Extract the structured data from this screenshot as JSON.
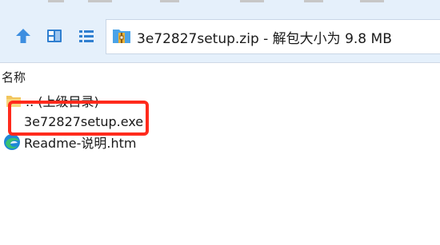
{
  "address_bar": {
    "title": "3e72827setup.zip - 解包大小为 9.8 MB"
  },
  "toolbar": {
    "buttons": [
      {
        "icon": "up-arrow-icon"
      },
      {
        "icon": "view-tiles-icon"
      },
      {
        "icon": "view-list-icon"
      }
    ]
  },
  "column_header": {
    "name_label": "名称"
  },
  "files": [
    {
      "name": ".. (上级目录)",
      "icon": "folder-icon"
    },
    {
      "name": "3e72827setup.exe",
      "icon": "none"
    },
    {
      "name": "Readme-说明.htm",
      "icon": "edge-browser-icon"
    }
  ],
  "colors": {
    "toolbar_bg": "#e5f0fb",
    "highlight": "#ff2a1c",
    "icon_blue": "#2a7fd4"
  }
}
